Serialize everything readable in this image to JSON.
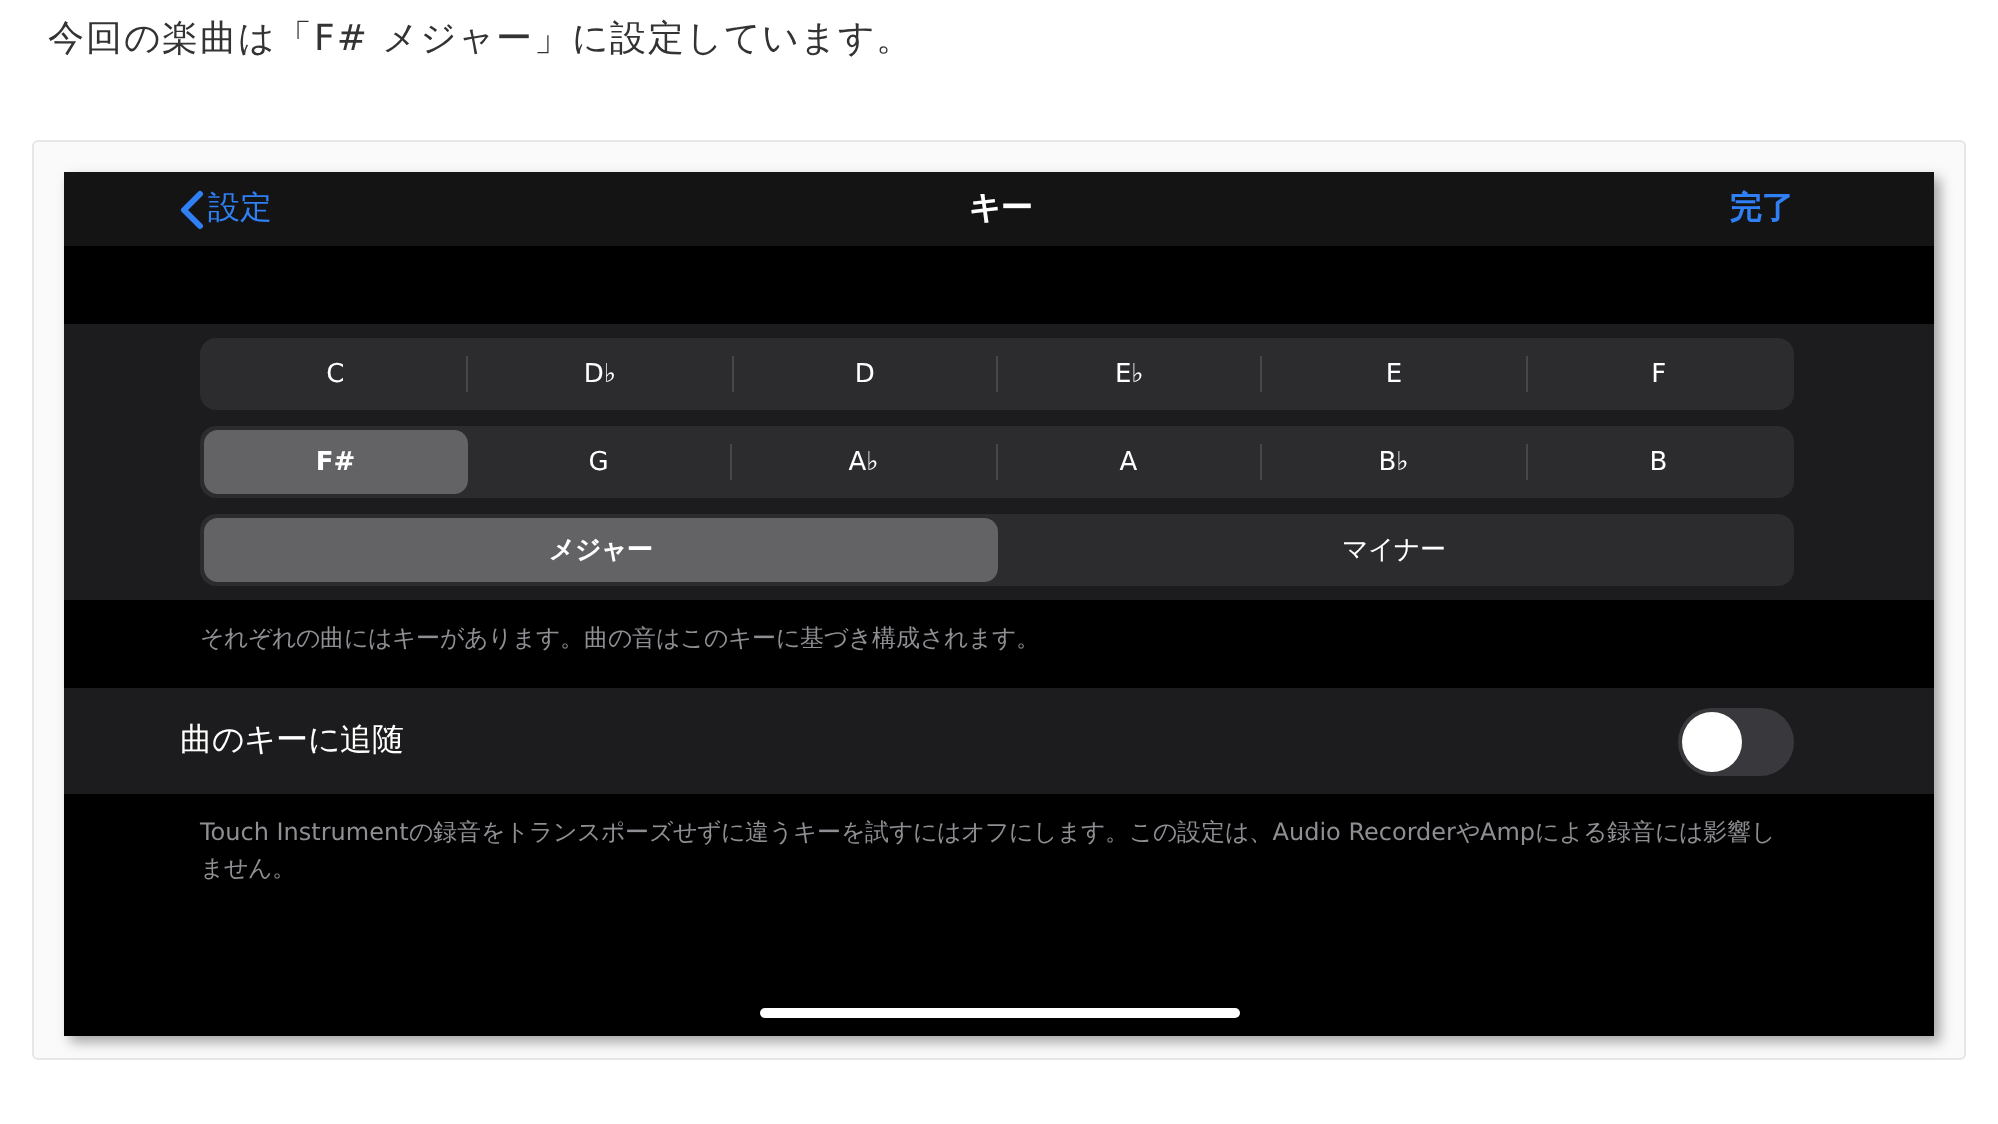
{
  "caption": "今回の楽曲は「F# メジャー」に設定しています。",
  "nav": {
    "back": "設定",
    "title": "キー",
    "done": "完了"
  },
  "key_rows": [
    [
      {
        "label": "C",
        "selected": false
      },
      {
        "label": "D♭",
        "selected": false
      },
      {
        "label": "D",
        "selected": false
      },
      {
        "label": "E♭",
        "selected": false
      },
      {
        "label": "E",
        "selected": false
      },
      {
        "label": "F",
        "selected": false
      }
    ],
    [
      {
        "label": "F#",
        "selected": true
      },
      {
        "label": "G",
        "selected": false
      },
      {
        "label": "A♭",
        "selected": false
      },
      {
        "label": "A",
        "selected": false
      },
      {
        "label": "B♭",
        "selected": false
      },
      {
        "label": "B",
        "selected": false
      }
    ]
  ],
  "modes": [
    {
      "label": "メジャー",
      "selected": true
    },
    {
      "label": "マイナー",
      "selected": false
    }
  ],
  "key_note": "それぞれの曲にはキーがあります。曲の音はこのキーに基づき構成されます。",
  "follow": {
    "label": "曲のキーに追随",
    "on": false
  },
  "follow_note": "Touch Instrumentの録音をトランスポーズせずに違うキーを試すにはオフにします。この設定は、Audio RecorderやAmpによる録音には影響しません。"
}
